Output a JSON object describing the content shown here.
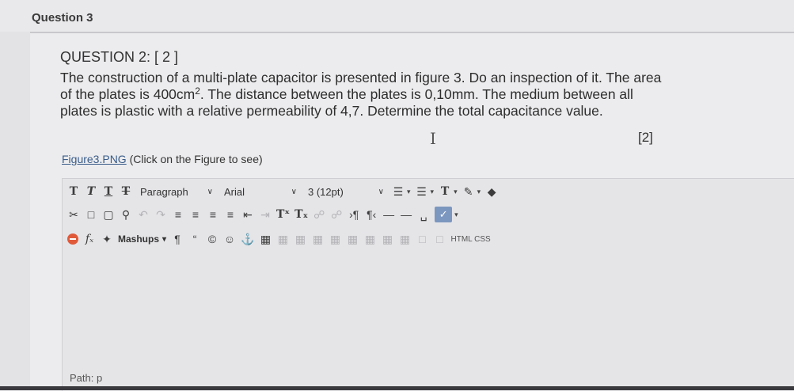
{
  "header": {
    "question_label": "Question 3"
  },
  "question": {
    "title": "QUESTION 2: [ 2 ]",
    "text_part1": "The construction of a multi-plate capacitor is presented in figure 3. Do an inspection of it. The area of the plates is 400cm",
    "text_sup": "2",
    "text_part2": ". The distance between the plates is 0,10mm. The medium between all plates is plastic with a relative permeability of 4,7. Determine the total capacitance value.",
    "marks": "[2]"
  },
  "figure": {
    "link_text": "Figure3.PNG",
    "hint": "(Click on the Figure to see)"
  },
  "toolbar": {
    "format_select": "Paragraph",
    "font_select": "Arial",
    "size_select": "3 (12pt)",
    "mashups_label": "Mashups",
    "html_css_label": "HTML CSS"
  },
  "editor": {
    "path": "Path: p"
  }
}
